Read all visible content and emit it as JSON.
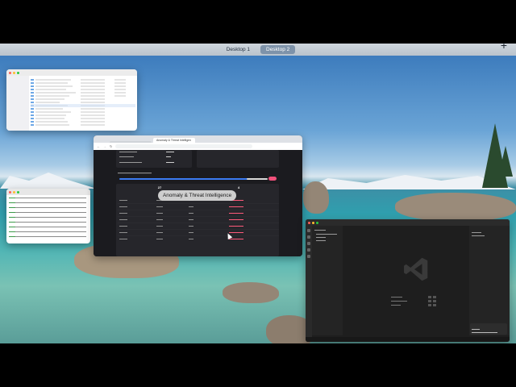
{
  "spaces": {
    "items": [
      {
        "label": "Desktop 1",
        "active": false
      },
      {
        "label": "Desktop 2",
        "active": true
      }
    ],
    "add_label": "+"
  },
  "finder": {
    "title": "",
    "sidebar": [
      "",
      "",
      "",
      "",
      "",
      "",
      "",
      ""
    ],
    "rows": [
      {
        "name": "",
        "date": ""
      }
    ]
  },
  "terminal": {
    "title": ""
  },
  "browser": {
    "tabs": [
      {
        "label": "",
        "active": false
      },
      {
        "label": "Anomaly & Threat Intelligen",
        "active": true
      }
    ],
    "url": "",
    "update_button": "",
    "flag_text": "",
    "stats": [
      {
        "value": "27",
        "label": ""
      },
      {
        "value": "4",
        "label": ""
      }
    ],
    "slider_badge": ""
  },
  "tooltip": {
    "text": "Anomaly & Threat Intelligence"
  },
  "vscode": {
    "title": "",
    "status": ""
  },
  "colors": {
    "accent_blue": "#3b7bf2",
    "flag_pink": "#ff5a7a",
    "badge_pink": "#f0507a",
    "vscode_bg": "#1e1e1e",
    "browser_bg": "#1b1b1f"
  }
}
